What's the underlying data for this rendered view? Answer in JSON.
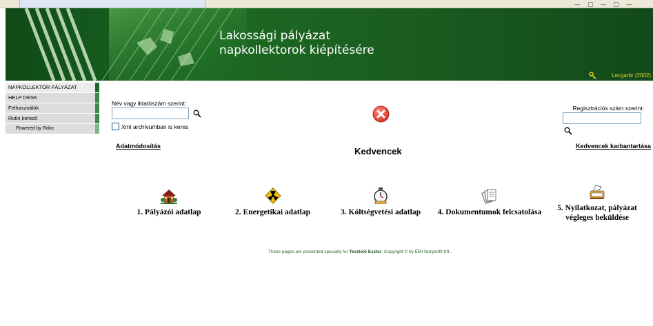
{
  "header": {
    "title_line1": "Lakossági pályázat",
    "title_line2": "napkollektorok kiépítésére",
    "user_text": "Lecgarbr  (2002)"
  },
  "sidebar": {
    "items": [
      {
        "label": "NAPKOLLEKTOR PÁLYÁZAT"
      },
      {
        "label": "HELP DESK"
      },
      {
        "label": "Felhasználók"
      },
      {
        "label": "Rutin kereső"
      }
    ],
    "powered": "Powered by Rdoc"
  },
  "search_left": {
    "label": "Név vagy iktatószám szerint:",
    "value": "",
    "xml_label": "Xml archivumban is keres",
    "xml_checked": false
  },
  "search_right": {
    "label": "Regisztrációs szám szerint:",
    "value": ""
  },
  "links": {
    "adatmod": "Adatmódosítás",
    "kedvencek_karb": "Kedvencek karbantartása"
  },
  "favorites": {
    "heading": "Kedvencek",
    "items": [
      {
        "label": "1. Pályázói adatlap",
        "icon": "house-icon"
      },
      {
        "label": "2. Energetikai adatlap",
        "icon": "hazard-icon"
      },
      {
        "label": "3. Költségvetési adatlap",
        "icon": "stopwatch-icon"
      },
      {
        "label": "4. Dokumentumok felcsatolása",
        "icon": "documents-icon"
      },
      {
        "label_line1": "5. Nyilatkozat, pályázat",
        "label_line2": "végleges beküldése",
        "icon": "mailbox-icon"
      }
    ]
  },
  "footer": {
    "prefix": "These pages are presented specially for ",
    "user": "Tesztelő Eszter",
    "copyright": ".   Copyright © by ÉMI Nonprofit Kft.."
  },
  "colors": {
    "banner_green": "#1b5e20",
    "nav_accent": "#3d8a4a",
    "footer_green": "#2d6b2d",
    "close_red": "#e04030"
  }
}
